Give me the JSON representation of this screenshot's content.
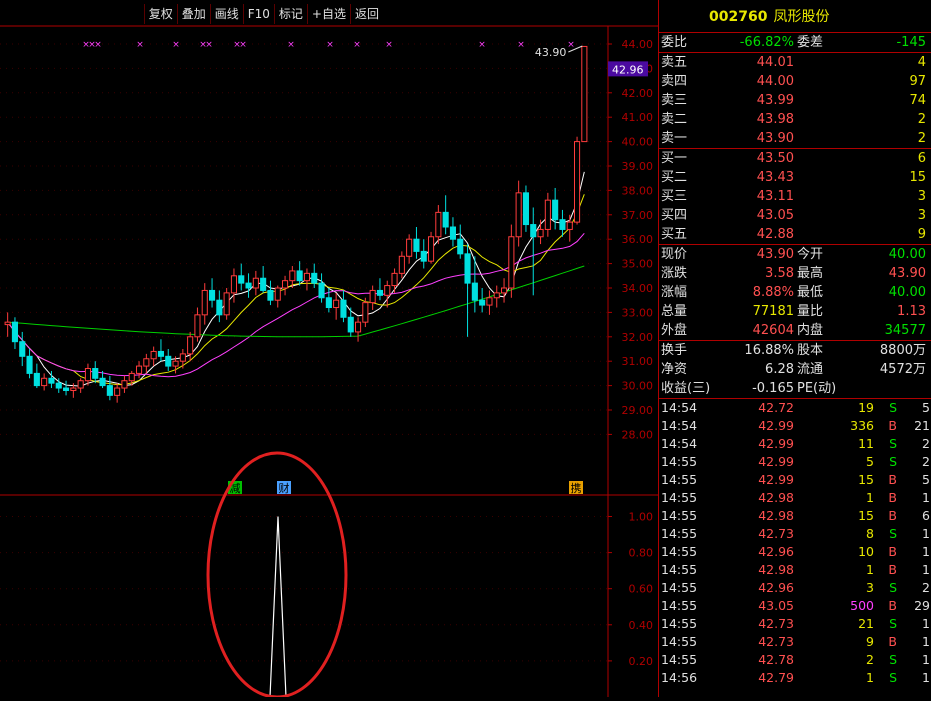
{
  "toolbar": [
    "复权",
    "叠加",
    "画线",
    "F10",
    "标记",
    "+自选",
    "返回"
  ],
  "stock": {
    "code": "002760",
    "name": "凤形股份"
  },
  "order": {
    "weibi_label": "委比",
    "weibi": "-66.82%",
    "weicha_label": "委差",
    "weicha": "-145",
    "asks": [
      {
        "label": "卖五",
        "price": "44.01",
        "vol": "4"
      },
      {
        "label": "卖四",
        "price": "44.00",
        "vol": "97"
      },
      {
        "label": "卖三",
        "price": "43.99",
        "vol": "74"
      },
      {
        "label": "卖二",
        "price": "43.98",
        "vol": "2"
      },
      {
        "label": "卖一",
        "price": "43.90",
        "vol": "2"
      }
    ],
    "bids": [
      {
        "label": "买一",
        "price": "43.50",
        "vol": "6"
      },
      {
        "label": "买二",
        "price": "43.43",
        "vol": "15"
      },
      {
        "label": "买三",
        "price": "43.11",
        "vol": "3"
      },
      {
        "label": "买四",
        "price": "43.05",
        "vol": "3"
      },
      {
        "label": "买五",
        "price": "42.88",
        "vol": "9"
      }
    ]
  },
  "quote": [
    {
      "l1": "现价",
      "v1": "43.90",
      "c1": "red",
      "l2": "今开",
      "v2": "40.00",
      "c2": "green"
    },
    {
      "l1": "涨跌",
      "v1": "3.58",
      "c1": "red",
      "l2": "最高",
      "v2": "43.90",
      "c2": "red"
    },
    {
      "l1": "涨幅",
      "v1": "8.88%",
      "c1": "red",
      "l2": "最低",
      "v2": "40.00",
      "c2": "green"
    },
    {
      "l1": "总量",
      "v1": "77181",
      "c1": "yellow",
      "l2": "量比",
      "v2": "1.13",
      "c2": "red"
    },
    {
      "l1": "外盘",
      "v1": "42604",
      "c1": "red",
      "l2": "内盘",
      "v2": "34577",
      "c2": "green"
    }
  ],
  "fund": [
    {
      "l1": "换手",
      "v1": "16.88%",
      "l2": "股本",
      "v2": "8800万"
    },
    {
      "l1": "净资",
      "v1": "6.28",
      "l2": "流通",
      "v2": "4572万"
    },
    {
      "l1": "收益(三)",
      "v1": "-0.165",
      "l2": "PE(动)",
      "v2": ""
    }
  ],
  "ticks": [
    {
      "t": "14:54",
      "p": "42.72",
      "v": "19",
      "bs": "S",
      "n": "5"
    },
    {
      "t": "14:54",
      "p": "42.99",
      "v": "336",
      "bs": "B",
      "n": "21"
    },
    {
      "t": "14:54",
      "p": "42.99",
      "v": "11",
      "bs": "S",
      "n": "2"
    },
    {
      "t": "14:55",
      "p": "42.99",
      "v": "5",
      "bs": "S",
      "n": "2"
    },
    {
      "t": "14:55",
      "p": "42.99",
      "v": "15",
      "bs": "B",
      "n": "5"
    },
    {
      "t": "14:55",
      "p": "42.98",
      "v": "1",
      "bs": "B",
      "n": "1"
    },
    {
      "t": "14:55",
      "p": "42.98",
      "v": "15",
      "bs": "B",
      "n": "6"
    },
    {
      "t": "14:55",
      "p": "42.73",
      "v": "8",
      "bs": "S",
      "n": "1"
    },
    {
      "t": "14:55",
      "p": "42.96",
      "v": "10",
      "bs": "B",
      "n": "1"
    },
    {
      "t": "14:55",
      "p": "42.98",
      "v": "1",
      "bs": "B",
      "n": "1"
    },
    {
      "t": "14:55",
      "p": "42.96",
      "v": "3",
      "bs": "S",
      "n": "2"
    },
    {
      "t": "14:55",
      "p": "43.05",
      "v": "500",
      "bs": "B",
      "n": "29"
    },
    {
      "t": "14:55",
      "p": "42.73",
      "v": "21",
      "bs": "S",
      "n": "1"
    },
    {
      "t": "14:55",
      "p": "42.73",
      "v": "9",
      "bs": "B",
      "n": "1"
    },
    {
      "t": "14:55",
      "p": "42.78",
      "v": "2",
      "bs": "S",
      "n": "1"
    },
    {
      "t": "14:56",
      "p": "42.79",
      "v": "1",
      "bs": "S",
      "n": "1"
    }
  ],
  "colors": {
    "up": "#ff3c3c",
    "down": "#00e0e0",
    "ma5": "#ffffff",
    "ma10": "#e8e800",
    "ma20": "#ff40ff",
    "ma60": "#00d000",
    "axis": "#b00000"
  },
  "chart_data": {
    "type": "candlestick",
    "ylim": [
      27.5,
      44.5
    ],
    "yticks": [
      "44.00",
      "43.00",
      "42.00",
      "41.00",
      "40.00",
      "39.00",
      "38.00",
      "37.00",
      "36.00",
      "35.00",
      "34.00",
      "33.00",
      "32.00",
      "31.00",
      "30.00",
      "29.00",
      "28.00"
    ],
    "current_price_label": "42.96",
    "high_annotation": "43.90",
    "event_markers": [
      "减",
      "财",
      "携"
    ],
    "signal_marks": "×",
    "candles": [
      [
        32.5,
        33.0,
        32.0,
        32.6
      ],
      [
        32.6,
        32.8,
        31.5,
        31.8
      ],
      [
        31.8,
        32.2,
        30.8,
        31.2
      ],
      [
        31.2,
        31.5,
        30.3,
        30.5
      ],
      [
        30.5,
        30.9,
        29.9,
        30.0
      ],
      [
        30.0,
        30.5,
        29.8,
        30.3
      ],
      [
        30.3,
        30.6,
        29.9,
        30.1
      ],
      [
        30.1,
        30.3,
        29.7,
        29.9
      ],
      [
        29.9,
        30.2,
        29.6,
        29.8
      ],
      [
        29.8,
        30.1,
        29.5,
        29.9
      ],
      [
        29.9,
        30.3,
        29.7,
        30.2
      ],
      [
        30.2,
        30.9,
        30.0,
        30.7
      ],
      [
        30.7,
        31.0,
        30.1,
        30.3
      ],
      [
        30.3,
        30.6,
        29.9,
        30.0
      ],
      [
        30.0,
        30.4,
        29.4,
        29.6
      ],
      [
        29.6,
        30.1,
        29.3,
        29.9
      ],
      [
        29.9,
        30.4,
        29.7,
        30.2
      ],
      [
        30.2,
        30.6,
        30.0,
        30.5
      ],
      [
        30.5,
        31.0,
        30.3,
        30.8
      ],
      [
        30.8,
        31.3,
        30.5,
        31.1
      ],
      [
        31.1,
        31.6,
        30.8,
        31.4
      ],
      [
        31.4,
        31.9,
        31.0,
        31.2
      ],
      [
        31.2,
        31.5,
        30.6,
        30.8
      ],
      [
        30.8,
        31.2,
        30.5,
        31.0
      ],
      [
        31.0,
        31.5,
        30.7,
        31.3
      ],
      [
        31.3,
        32.2,
        31.0,
        32.0
      ],
      [
        32.0,
        33.2,
        31.8,
        32.9
      ],
      [
        32.9,
        34.2,
        32.5,
        33.9
      ],
      [
        33.9,
        34.4,
        33.2,
        33.5
      ],
      [
        33.5,
        33.9,
        32.6,
        32.9
      ],
      [
        32.9,
        34.0,
        32.7,
        33.8
      ],
      [
        33.8,
        34.8,
        33.4,
        34.5
      ],
      [
        34.5,
        35.0,
        33.9,
        34.2
      ],
      [
        34.2,
        34.6,
        33.6,
        34.0
      ],
      [
        34.0,
        34.7,
        33.7,
        34.4
      ],
      [
        34.4,
        34.9,
        33.8,
        33.9
      ],
      [
        33.9,
        34.3,
        33.3,
        33.5
      ],
      [
        33.5,
        34.1,
        33.2,
        34.0
      ],
      [
        34.0,
        34.5,
        33.7,
        34.3
      ],
      [
        34.3,
        34.9,
        34.0,
        34.7
      ],
      [
        34.7,
        35.1,
        34.1,
        34.3
      ],
      [
        34.3,
        34.8,
        33.9,
        34.6
      ],
      [
        34.6,
        35.0,
        34.0,
        34.2
      ],
      [
        34.2,
        34.6,
        33.4,
        33.6
      ],
      [
        33.6,
        34.0,
        33.0,
        33.2
      ],
      [
        33.2,
        33.8,
        32.7,
        33.5
      ],
      [
        33.5,
        33.9,
        32.6,
        32.8
      ],
      [
        32.8,
        33.2,
        32.0,
        32.2
      ],
      [
        32.2,
        32.8,
        31.8,
        32.6
      ],
      [
        32.6,
        33.6,
        32.4,
        33.4
      ],
      [
        33.4,
        34.1,
        33.1,
        33.9
      ],
      [
        33.9,
        34.4,
        33.5,
        33.7
      ],
      [
        33.7,
        34.3,
        33.2,
        34.1
      ],
      [
        34.1,
        34.8,
        33.8,
        34.6
      ],
      [
        34.6,
        35.5,
        34.4,
        35.3
      ],
      [
        35.3,
        36.2,
        35.0,
        36.0
      ],
      [
        36.0,
        36.5,
        35.2,
        35.5
      ],
      [
        35.5,
        36.0,
        34.8,
        35.1
      ],
      [
        35.1,
        36.3,
        35.0,
        36.1
      ],
      [
        36.1,
        37.4,
        35.8,
        37.1
      ],
      [
        37.1,
        37.8,
        36.2,
        36.5
      ],
      [
        36.5,
        36.9,
        35.7,
        36.0
      ],
      [
        36.0,
        36.6,
        35.2,
        35.4
      ],
      [
        35.4,
        35.8,
        32.0,
        34.2
      ],
      [
        34.2,
        35.3,
        33.0,
        33.5
      ],
      [
        33.5,
        34.0,
        33.0,
        33.3
      ],
      [
        33.3,
        33.9,
        32.9,
        33.6
      ],
      [
        33.6,
        34.1,
        33.2,
        33.8
      ],
      [
        33.8,
        34.4,
        33.4,
        34.0
      ],
      [
        34.0,
        36.6,
        33.6,
        36.1
      ],
      [
        36.1,
        38.4,
        35.7,
        37.9
      ],
      [
        37.9,
        38.2,
        36.3,
        36.6
      ],
      [
        36.6,
        37.3,
        33.7,
        36.1
      ],
      [
        36.1,
        36.8,
        35.8,
        36.4
      ],
      [
        36.4,
        37.9,
        36.1,
        37.6
      ],
      [
        37.6,
        38.1,
        36.4,
        36.8
      ],
      [
        36.8,
        37.2,
        36.1,
        36.4
      ],
      [
        36.4,
        37.0,
        35.9,
        36.7
      ],
      [
        36.7,
        40.2,
        36.6,
        40.0
      ],
      [
        40.0,
        43.9,
        40.0,
        43.9
      ]
    ],
    "lower_indicator": {
      "yticks": [
        "1.00",
        "0.80",
        "0.60",
        "0.40",
        "0.20"
      ],
      "ylim": [
        0,
        1.1
      ],
      "spike_value": 1.0
    }
  }
}
